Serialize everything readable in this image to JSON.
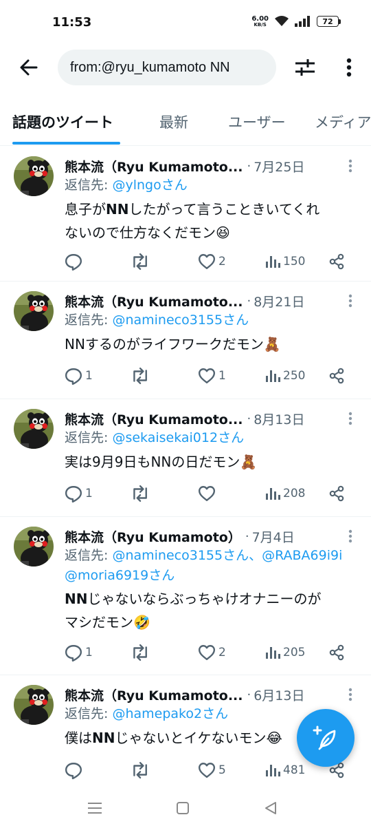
{
  "status_bar": {
    "time": "11:53",
    "net_speed_value": "6.00",
    "net_speed_unit": "KB/S",
    "battery": "72"
  },
  "search": {
    "query": "from:@ryu_kumamoto NN"
  },
  "tabs": [
    {
      "label": "話題のツイート",
      "active": true
    },
    {
      "label": "最新",
      "active": false
    },
    {
      "label": "ユーザー",
      "active": false
    },
    {
      "label": "メディア",
      "active": false
    }
  ],
  "tweets": [
    {
      "name": "熊本流（Ryu Kumamoto...",
      "date": "7月25日",
      "reply_prefix": "返信先: ",
      "reply_handles": "@ylngoさん",
      "reply_handles_line2": "",
      "text_line1_a": "息子が",
      "text_line1_bold": "NN",
      "text_line1_b": "したがって言うこときいてくれ",
      "text_line2": "ないので仕方なくだモン😆",
      "replies": "",
      "retweets": "",
      "likes": "2",
      "views": "150"
    },
    {
      "name": "熊本流（Ryu Kumamoto...",
      "date": "8月21日",
      "reply_prefix": "返信先: ",
      "reply_handles": "@namineco3155さん",
      "text_line1": "NNするのがライフワークだモン🧸",
      "replies": "1",
      "retweets": "",
      "likes": "1",
      "views": "250"
    },
    {
      "name": "熊本流（Ryu Kumamoto...",
      "date": "8月13日",
      "reply_prefix": "返信先: ",
      "reply_handles": "@sekaisekai012さん",
      "text_line1": "実は9月9日もNNの日だモン🧸",
      "replies": "1",
      "retweets": "",
      "likes": "",
      "views": "208"
    },
    {
      "name": "熊本流（Ryu Kumamoto）",
      "date": "7月4日",
      "reply_prefix": "返信先: ",
      "reply_handles": "@namineco3155さん、@RABA69i9i",
      "reply_handles_line2": "@moria6919さん",
      "text_line1_bold": "NN",
      "text_line1_b": "じゃないならぶっちゃけオナニーのが",
      "text_line2": "マシだモン🤣",
      "replies": "1",
      "retweets": "",
      "likes": "2",
      "views": "205"
    },
    {
      "name": "熊本流（Ryu Kumamoto...",
      "date": "6月13日",
      "reply_prefix": "返信先: ",
      "reply_handles": "@hamepako2さん",
      "text_line1_a": "僕は",
      "text_line1_bold": "NN",
      "text_line1_b": "じゃないとイケないモン😂",
      "replies": "",
      "retweets": "",
      "likes": "5",
      "views": "481"
    }
  ],
  "colors": {
    "accent": "#1d9bf0",
    "text_primary": "#0f1419",
    "text_secondary": "#536471",
    "search_bg": "#eff3f4"
  },
  "icons": [
    "back-arrow-icon",
    "filter-icon",
    "more-vertical-icon",
    "reply-icon",
    "retweet-icon",
    "like-icon",
    "views-icon",
    "share-icon",
    "compose-icon"
  ]
}
